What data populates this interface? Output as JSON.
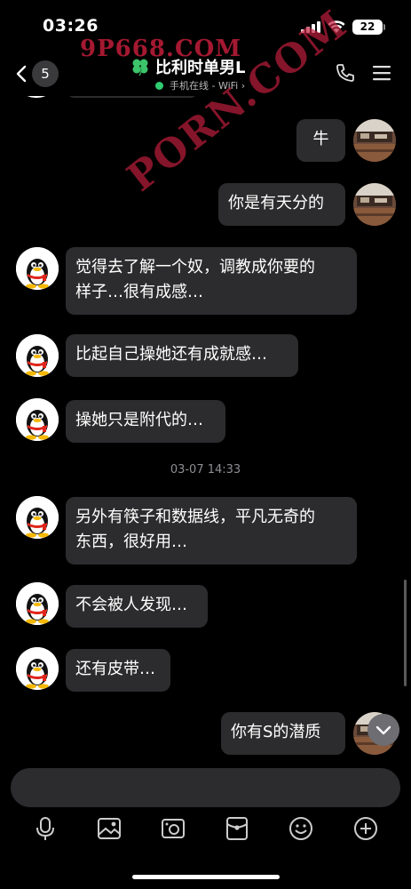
{
  "status_bar": {
    "time": "03:26",
    "battery_level": "22"
  },
  "header": {
    "unread_count": "5",
    "contact_name": "比利时单男L",
    "online_status": "手机在线 - WiFi ›"
  },
  "watermarks": {
    "top": "9P668.COM",
    "diagonal": "PORN.COM"
  },
  "messages": [
    {
      "sender": "me",
      "text": "牛"
    },
    {
      "sender": "me",
      "text": "你是有天分的"
    },
    {
      "sender": "contact",
      "line1": "觉得去了解一个奴，调教成你要的",
      "line2": "样子…很有成感…"
    },
    {
      "sender": "contact",
      "text": "比起自己操她还有成就感…"
    },
    {
      "sender": "contact",
      "text": "操她只是附代的…"
    },
    {
      "type": "timestamp",
      "text": "03-07 14:33"
    },
    {
      "sender": "contact",
      "line1": "另外有筷子和数据线，平凡无奇的",
      "line2": "东西，很好用…"
    },
    {
      "sender": "contact",
      "text": "不会被人发现…"
    },
    {
      "sender": "contact",
      "text": "还有皮带…"
    },
    {
      "sender": "me",
      "text": "你有S的潜质"
    }
  ],
  "input": {
    "value": "",
    "placeholder": ""
  },
  "toolbar": {
    "icons": [
      "microphone-icon",
      "image-icon",
      "camera-icon",
      "red-packet-icon",
      "emoji-icon",
      "plus-icon"
    ]
  },
  "colors": {
    "background": "#000000",
    "bubble": "#2c2c2e",
    "online": "#2fcc71",
    "watermark": "#c81e3c"
  }
}
